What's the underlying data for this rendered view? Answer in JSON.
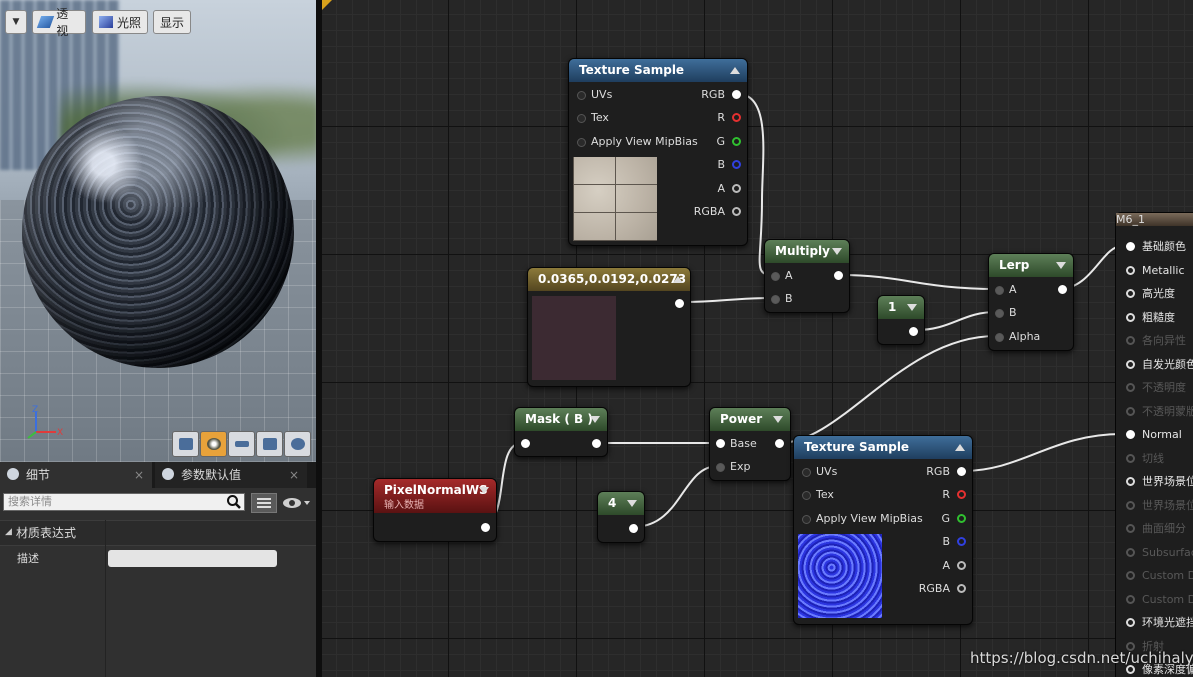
{
  "viewport": {
    "toolbar": {
      "perspective": "透视",
      "lighting": "光照",
      "show": "显示"
    },
    "axes": {
      "z": "Z",
      "x": "X"
    }
  },
  "details": {
    "tabs": [
      {
        "label": "细节"
      },
      {
        "label": "参数默认值"
      }
    ],
    "search_placeholder": "搜索详情",
    "category": "材质表达式",
    "property": {
      "label": "描述",
      "value": ""
    }
  },
  "graph": {
    "nodes": {
      "texture_sample_1": {
        "title": "Texture Sample",
        "inputs": [
          "UVs",
          "Tex",
          "Apply View MipBias"
        ],
        "outputs": [
          "RGB",
          "R",
          "G",
          "B",
          "A",
          "RGBA"
        ]
      },
      "multiply": {
        "title": "Multiply",
        "inputs": [
          "A",
          "B"
        ]
      },
      "constant3": {
        "title": "0.0365,0.0192,0.0273",
        "color": "#3c2a32"
      },
      "constant_1": {
        "title": "1"
      },
      "lerp": {
        "title": "Lerp",
        "inputs": [
          "A",
          "B",
          "Alpha"
        ]
      },
      "mask": {
        "title": "Mask ( B )"
      },
      "power": {
        "title": "Power",
        "inputs": [
          "Base",
          "Exp"
        ]
      },
      "pixel_normal": {
        "title": "PixelNormalWS",
        "subtitle": "输入数据"
      },
      "constant_4": {
        "title": "4"
      },
      "texture_sample_2": {
        "title": "Texture Sample",
        "inputs": [
          "UVs",
          "Tex",
          "Apply View MipBias"
        ],
        "outputs": [
          "RGB",
          "R",
          "G",
          "B",
          "A",
          "RGBA"
        ]
      }
    },
    "result": {
      "title": "M6_1",
      "pins": [
        {
          "label": "基础颜色",
          "active": true
        },
        {
          "label": "Metallic",
          "active": true
        },
        {
          "label": "高光度",
          "active": true
        },
        {
          "label": "粗糙度",
          "active": true
        },
        {
          "label": "各向异性",
          "active": false
        },
        {
          "label": "自发光颜色",
          "active": true
        },
        {
          "label": "不透明度",
          "active": false
        },
        {
          "label": "不透明蒙版",
          "active": false
        },
        {
          "label": "Normal",
          "active": true
        },
        {
          "label": "切线",
          "active": false
        },
        {
          "label": "世界场景位",
          "active": true
        },
        {
          "label": "世界场景位",
          "active": false
        },
        {
          "label": "曲面细分",
          "active": false
        },
        {
          "label": "Subsurfac",
          "active": false
        },
        {
          "label": "Custom D",
          "active": false
        },
        {
          "label": "Custom D",
          "active": false
        },
        {
          "label": "环境光遮挡",
          "active": true
        },
        {
          "label": "折射",
          "active": false
        },
        {
          "label": "像素深度偏",
          "active": true
        }
      ]
    }
  },
  "watermark": "https://blog.csdn.net/uchihalyn",
  "colors": {
    "pin_red": "#e53030",
    "pin_green": "#30c030",
    "pin_blue": "#3040e0",
    "accent": "#e8a23a"
  }
}
